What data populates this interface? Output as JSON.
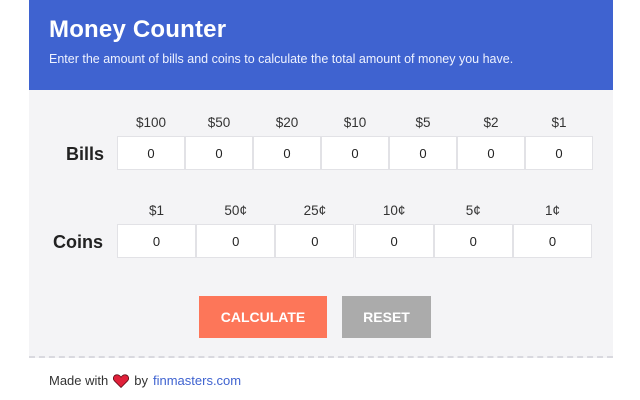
{
  "header": {
    "title": "Money Counter",
    "subtitle": "Enter the amount of bills and coins to calculate the total amount of money you have."
  },
  "bills": {
    "label": "Bills",
    "items": [
      {
        "denom": "$100",
        "value": "0"
      },
      {
        "denom": "$50",
        "value": "0"
      },
      {
        "denom": "$20",
        "value": "0"
      },
      {
        "denom": "$10",
        "value": "0"
      },
      {
        "denom": "$5",
        "value": "0"
      },
      {
        "denom": "$2",
        "value": "0"
      },
      {
        "denom": "$1",
        "value": "0"
      }
    ]
  },
  "coins": {
    "label": "Coins",
    "items": [
      {
        "denom": "$1",
        "value": "0"
      },
      {
        "denom": "50¢",
        "value": "0"
      },
      {
        "denom": "25¢",
        "value": "0"
      },
      {
        "denom": "10¢",
        "value": "0"
      },
      {
        "denom": "5¢",
        "value": "0"
      },
      {
        "denom": "1¢",
        "value": "0"
      }
    ]
  },
  "actions": {
    "calculate_label": "CALCULATE",
    "reset_label": "RESET"
  },
  "footer": {
    "made_with": "Made with",
    "by": "by",
    "link_text": "finmasters.com",
    "heart_icon": "heart-icon"
  },
  "colors": {
    "header_bg": "#3f63d0",
    "calculate_bg": "#fd7659",
    "reset_bg": "#ababab",
    "heart": "#e0203a"
  }
}
